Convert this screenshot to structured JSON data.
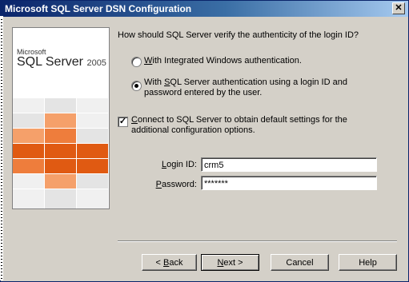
{
  "window": {
    "title": "Microsoft SQL Server DSN Configuration",
    "close_glyph": "✕"
  },
  "logo": {
    "microsoft": "Microsoft",
    "product": "SQL Server",
    "version": "2005",
    "tile_colors": {
      "orange_dark": "#e05a12",
      "orange_mid": "#ee7d3c",
      "orange_light": "#f5a06a",
      "grey_light": "#f0f0f0",
      "grey_mid": "#e4e4e4"
    }
  },
  "auth": {
    "question": "How should SQL Server verify the authenticity of the login ID?",
    "options": [
      {
        "label_pre": "",
        "label_key": "W",
        "label_post": "ith Integrated Windows authentication.",
        "selected": false
      },
      {
        "label_pre": "With ",
        "label_key": "S",
        "label_post": "QL Server authentication using a login ID and password entered by the user.",
        "selected": true
      }
    ]
  },
  "connect": {
    "label_key": "C",
    "label_post": "onnect to SQL Server to obtain default settings for the additional configuration options.",
    "checked": true,
    "check_glyph": "✓"
  },
  "login": {
    "id_label_pre": "",
    "id_label_key": "L",
    "id_label_post": "ogin ID:",
    "id_value": "crm5",
    "password_label_pre": "",
    "password_label_key": "P",
    "password_label_post": "assword:",
    "password_value": "*******"
  },
  "buttons": {
    "back_pre": "< ",
    "back_key": "B",
    "back_post": "ack",
    "next_key": "N",
    "next_post": "ext >",
    "cancel": "Cancel",
    "help": "Help"
  }
}
